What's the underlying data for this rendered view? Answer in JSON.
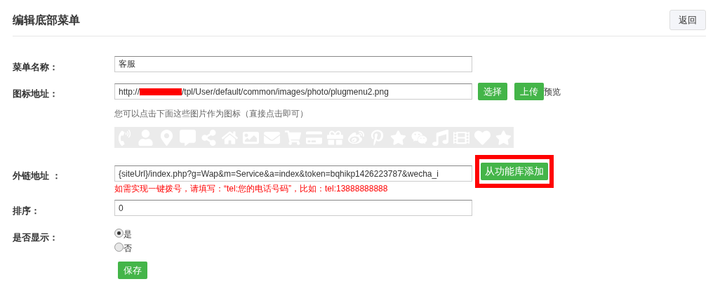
{
  "header": {
    "title": "编辑底部菜单",
    "back_button": "返回"
  },
  "fields": [
    {
      "kind": "text",
      "label": "菜单名称：",
      "value": "客服"
    },
    {
      "kind": "icon_url",
      "label": "图标地址：",
      "value_before": "http://",
      "value_after": "/tpl/User/default/common/images/photo/plugmenu2.png",
      "buttons": [
        "选择",
        "上传"
      ],
      "link": "预览",
      "hint": "您可以点击下面这些图片作为图标（直接点击即可）"
    },
    {
      "kind": "link_url",
      "label": "外链地址 ：",
      "value": "{siteUrl}/index.php?g=Wap&m=Service&a=index&token=bqhikp1426223787&wecha_i",
      "button": "从功能库添加",
      "note": "如需实现一键拨号，请填写：“tel:您的电话号码”，比如：tel:13888888888"
    },
    {
      "kind": "text",
      "label": "排序：",
      "value": "0"
    },
    {
      "kind": "radio",
      "label": "是否显示：",
      "options": [
        {
          "label": "是",
          "selected": true
        },
        {
          "label": "否",
          "selected": false
        }
      ]
    }
  ],
  "save_button": "保存"
}
